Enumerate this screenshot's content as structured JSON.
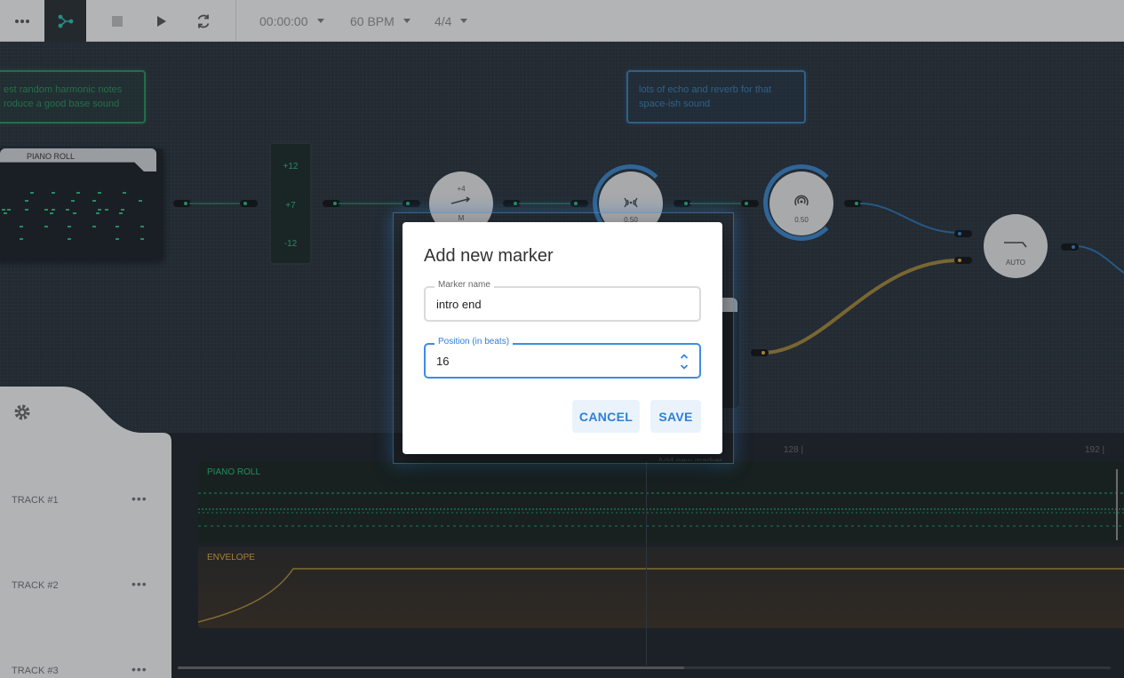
{
  "toolbar": {
    "time": "00:00:00",
    "bpm": "60 BPM",
    "signature": "4/4"
  },
  "graph": {
    "note_left": "...st random harmonic notes\n...oduce a good base sound",
    "note_left_l1": "est random harmonic notes",
    "note_left_l2": "roduce a good base sound",
    "note_right_l1": "lots of echo and reverb for that",
    "note_right_l2": "space-ish sound",
    "piano_node_title": "PIANO ROLL",
    "transpose_values": [
      "+12",
      "+7",
      "-12"
    ],
    "pitch_knob_value": "+4",
    "pitch_knob_mode": "M",
    "echo_knob_value": "0.50",
    "reverb_knob_value": "0.50",
    "auto_knob_label": "AUTO"
  },
  "sidebar": {
    "tracks": [
      {
        "label": "TRACK #1"
      },
      {
        "label": "TRACK #2"
      },
      {
        "label": "TRACK #3"
      }
    ]
  },
  "timeline": {
    "ruler_marks": [
      "128 |",
      "192 |"
    ],
    "lanes": [
      {
        "title": "PIANO ROLL",
        "color": "#2bb37a"
      },
      {
        "title": "ENVELOPE",
        "color": "#d9a43a"
      }
    ],
    "ghost_text": "Add new marker"
  },
  "dialog": {
    "title": "Add new marker",
    "marker_name": {
      "label": "Marker name",
      "value": "intro end"
    },
    "position": {
      "label": "Position (in beats)",
      "value": "16"
    },
    "cancel_label": "CANCEL",
    "save_label": "SAVE"
  },
  "colors": {
    "accent": "#2f7fd6",
    "green_signal": "#2bb37a",
    "yellow_signal": "#d9a43a",
    "wire_blue": "#3a7fc0"
  }
}
